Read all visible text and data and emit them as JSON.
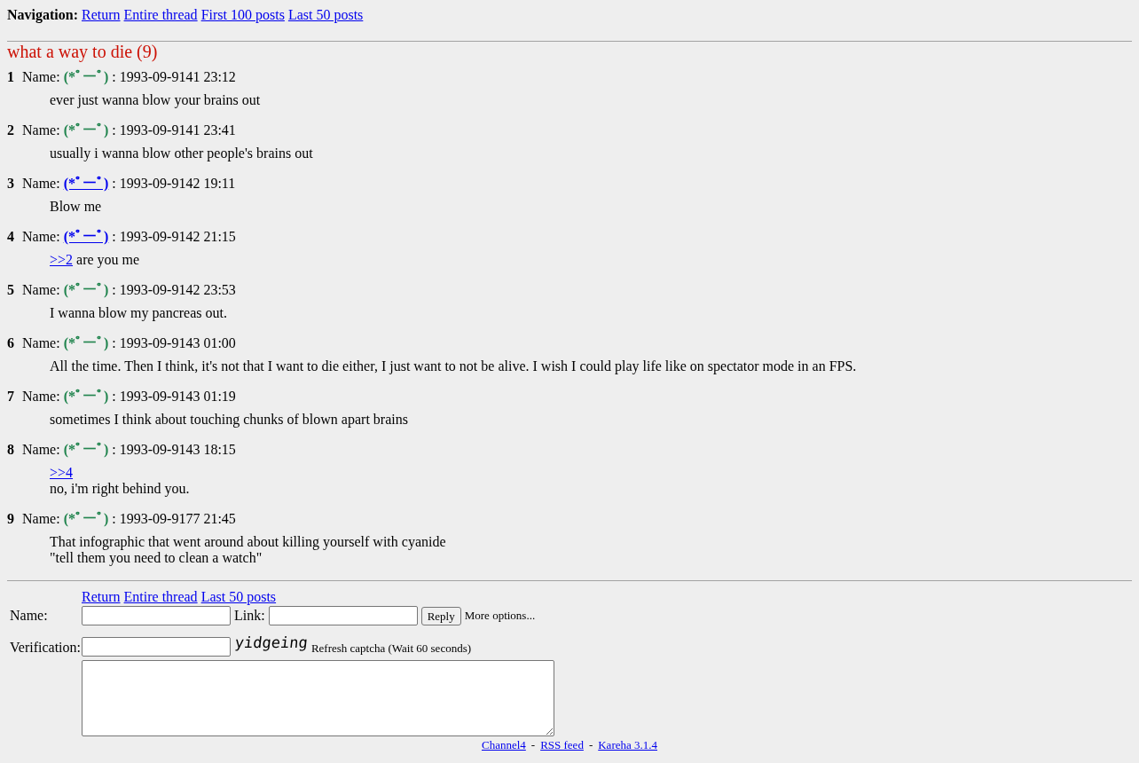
{
  "navigation": {
    "label": "Navigation:",
    "links": [
      "Return",
      "Entire thread",
      "First 100 posts",
      "Last 50 posts"
    ]
  },
  "thread": {
    "title": "what a way to die (9)"
  },
  "posts": [
    {
      "number": "1",
      "name_label": "Name:",
      "name": "(*ﾟーﾟ)",
      "linked": false,
      "date": ": 1993-09-9141 23:12",
      "body": [
        [
          {
            "kind": "text",
            "text": "ever just wanna blow your brains out"
          }
        ]
      ]
    },
    {
      "number": "2",
      "name_label": "Name:",
      "name": "(*ﾟーﾟ)",
      "linked": false,
      "date": ": 1993-09-9141 23:41",
      "body": [
        [
          {
            "kind": "text",
            "text": "usually i wanna blow other people's brains out"
          }
        ]
      ]
    },
    {
      "number": "3",
      "name_label": "Name:",
      "name": "(*ﾟーﾟ)",
      "linked": true,
      "date": ": 1993-09-9142 19:11",
      "body": [
        [
          {
            "kind": "text",
            "text": "Blow me"
          }
        ]
      ]
    },
    {
      "number": "4",
      "name_label": "Name:",
      "name": "(*ﾟーﾟ)",
      "linked": true,
      "date": ": 1993-09-9142 21:15",
      "body": [
        [
          {
            "kind": "link",
            "text": ">>2"
          },
          {
            "kind": "text",
            "text": "are you me"
          }
        ]
      ]
    },
    {
      "number": "5",
      "name_label": "Name:",
      "name": "(*ﾟーﾟ)",
      "linked": false,
      "date": ": 1993-09-9142 23:53",
      "body": [
        [
          {
            "kind": "text",
            "text": "I wanna blow my pancreas out."
          }
        ]
      ]
    },
    {
      "number": "6",
      "name_label": "Name:",
      "name": "(*ﾟーﾟ)",
      "linked": false,
      "date": ": 1993-09-9143 01:00",
      "body": [
        [
          {
            "kind": "text",
            "text": "All the time. Then I think, it's not that I want to die either, I just want to not be alive. I wish I could play life like on spectator mode in an FPS."
          }
        ]
      ]
    },
    {
      "number": "7",
      "name_label": "Name:",
      "name": "(*ﾟーﾟ)",
      "linked": false,
      "date": ": 1993-09-9143 01:19",
      "body": [
        [
          {
            "kind": "text",
            "text": "sometimes I think about touching chunks of blown apart brains"
          }
        ]
      ]
    },
    {
      "number": "8",
      "name_label": "Name:",
      "name": "(*ﾟーﾟ)",
      "linked": false,
      "date": ": 1993-09-9143 18:15",
      "body": [
        [
          {
            "kind": "link",
            "text": ">>4"
          }
        ],
        [
          {
            "kind": "text",
            "text": "no, i'm right behind you."
          }
        ]
      ]
    },
    {
      "number": "9",
      "name_label": "Name:",
      "name": "(*ﾟーﾟ)",
      "linked": false,
      "date": ": 1993-09-9177 21:45",
      "body": [
        [
          {
            "kind": "text",
            "text": "That infographic that went around about killing yourself with cyanide"
          }
        ],
        [
          {
            "kind": "text",
            "text": "\"tell them you need to clean a watch\""
          }
        ]
      ]
    }
  ],
  "reply_form": {
    "links": [
      "Return",
      "Entire thread",
      "Last 50 posts"
    ],
    "name_label": "Name:",
    "link_label": "Link:",
    "reply_button": "Reply",
    "more_options": "More options...",
    "verification_label": "Verification:",
    "captcha_text": "yidgeing",
    "captcha_note": "Refresh captcha (Wait 60 seconds)"
  },
  "footer": {
    "items": [
      {
        "kind": "link",
        "text": "Channel4"
      },
      {
        "kind": "separator",
        "text": "-"
      },
      {
        "kind": "link",
        "text": "RSS feed"
      },
      {
        "kind": "separator",
        "text": "-"
      },
      {
        "kind": "link",
        "text": "Kareha 3.1.4"
      }
    ]
  }
}
